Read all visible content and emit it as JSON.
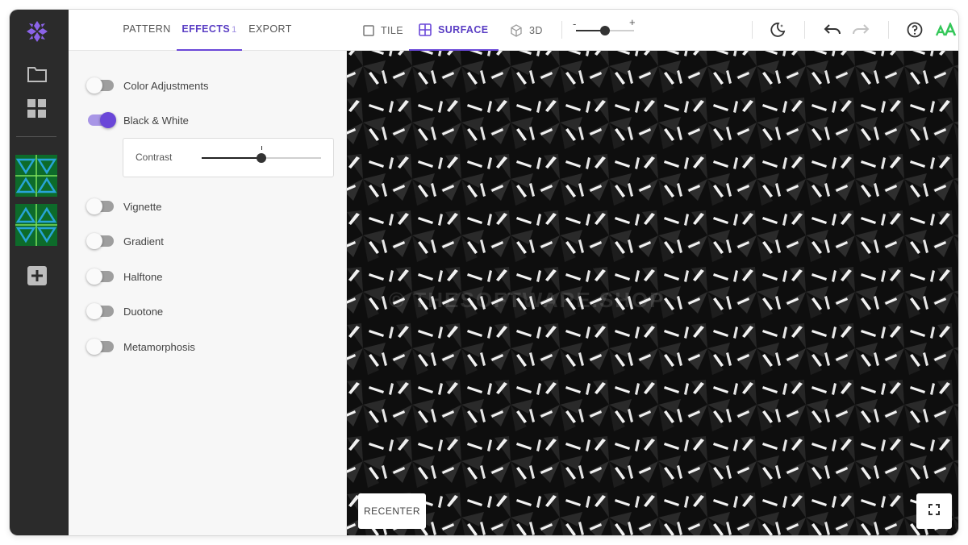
{
  "panel": {
    "tabs": [
      {
        "label": "PATTERN"
      },
      {
        "label": "EFFECTS",
        "badge": "1"
      },
      {
        "label": "EXPORT"
      }
    ],
    "effects": [
      {
        "label": "Color Adjustments",
        "enabled": false
      },
      {
        "label": "Black & White",
        "enabled": true
      },
      {
        "label": "Vignette",
        "enabled": false
      },
      {
        "label": "Gradient",
        "enabled": false
      },
      {
        "label": "Halftone",
        "enabled": false
      },
      {
        "label": "Duotone",
        "enabled": false
      },
      {
        "label": "Metamorphosis",
        "enabled": false
      }
    ],
    "contrast": {
      "label": "Contrast",
      "value": 0.5
    }
  },
  "toolbar": {
    "view_tabs": [
      {
        "label": "TILE"
      },
      {
        "label": "SURFACE"
      },
      {
        "label": "3D"
      }
    ],
    "zoom": {
      "minus": "-",
      "plus": "+",
      "value": 0.5
    }
  },
  "canvas": {
    "watermark": "© THESOFTWARE.SHOP",
    "recenter_label": "RECENTER"
  },
  "colors": {
    "accent": "#6a47d8",
    "rail": "#2b2b2b",
    "canvas": "#0c0c0c",
    "font_toggle": "#34c759"
  }
}
